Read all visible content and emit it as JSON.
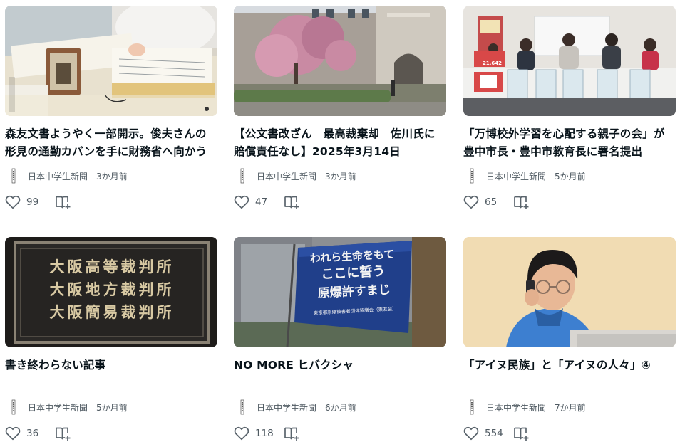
{
  "cards": [
    {
      "title": "森友文書ようやく一部開示。俊夫さんの形見の通勤カバンを手に財務省へ向かう",
      "creator": "日本中学生新聞",
      "time": "3か月前",
      "likes": "99"
    },
    {
      "title": "【公文書改ざん　最高裁棄却　佐川氏に賠償責任なし】2025年3月14日",
      "creator": "日本中学生新聞",
      "time": "3か月前",
      "likes": "47"
    },
    {
      "title": "「万博校外学習を心配する親子の会」が豊中市長・豊中市教育長に署名提出",
      "creator": "日本中学生新聞",
      "time": "5か月前",
      "likes": "65"
    },
    {
      "title": "書き終わらない記事",
      "creator": "日本中学生新聞",
      "time": "5か月前",
      "likes": "36"
    },
    {
      "title": "NO MORE ヒバクシャ",
      "creator": "日本中学生新聞",
      "time": "6か月前",
      "likes": "118"
    },
    {
      "title": "「アイヌ民族」と「アイヌの人々」④",
      "creator": "日本中学生新聞",
      "time": "7か月前",
      "likes": "554"
    }
  ],
  "images": {
    "court_sign": [
      "大阪高等裁判所",
      "大阪地方裁判所",
      "大阪簡易裁判所"
    ],
    "banner": [
      "われら生命をもて",
      "ここに誓う",
      "原爆許すまじ",
      "東京都原爆被害者団体協議会（東友会）"
    ],
    "press_board": "21,642",
    "stamp": "日本中学生新聞"
  },
  "icons": {
    "like": "heart-icon",
    "save": "magazine-add-icon",
    "avatar": "creator-avatar-icon"
  },
  "colors": {
    "text": "#08131a",
    "muted": "#4f5a62",
    "icon": "#5a646c"
  }
}
